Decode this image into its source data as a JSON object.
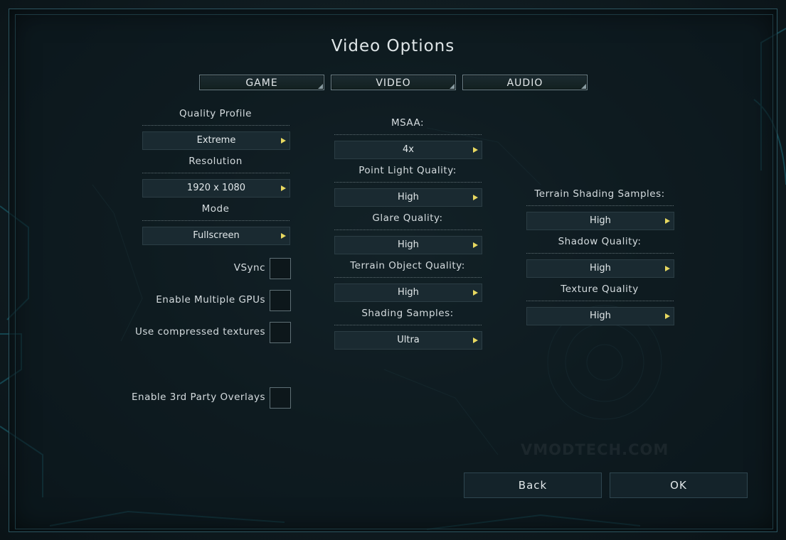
{
  "title": "Video Options",
  "tabs": [
    "GAME",
    "VIDEO",
    "AUDIO"
  ],
  "left": {
    "quality_profile": {
      "label": "Quality Profile",
      "value": "Extreme"
    },
    "resolution": {
      "label": "Resolution",
      "value": "1920 x 1080"
    },
    "mode": {
      "label": "Mode",
      "value": "Fullscreen"
    },
    "checkboxes": [
      {
        "label": "VSync",
        "checked": false
      },
      {
        "label": "Enable Multiple GPUs",
        "checked": false
      },
      {
        "label": "Use compressed textures",
        "checked": false
      },
      {
        "label": "Enable 3rd Party Overlays",
        "checked": false
      }
    ]
  },
  "middle": {
    "msaa": {
      "label": "MSAA:",
      "value": "4x"
    },
    "point_light": {
      "label": "Point Light Quality:",
      "value": "High"
    },
    "glare": {
      "label": "Glare Quality:",
      "value": "High"
    },
    "terrain_object": {
      "label": "Terrain Object Quality:",
      "value": "High"
    },
    "shading_samples": {
      "label": "Shading Samples:",
      "value": "Ultra"
    }
  },
  "right": {
    "terrain_shading": {
      "label": "Terrain Shading Samples:",
      "value": "High"
    },
    "shadow": {
      "label": "Shadow Quality:",
      "value": "High"
    },
    "texture": {
      "label": "Texture Quality",
      "value": "High"
    }
  },
  "buttons": {
    "back": "Back",
    "ok": "OK"
  },
  "icons": {
    "dropdown_arrow": "triangle-right-icon"
  },
  "colors": {
    "arrow": "#e8d860",
    "frame": "#2c5560",
    "panel": "#1a2a31"
  }
}
